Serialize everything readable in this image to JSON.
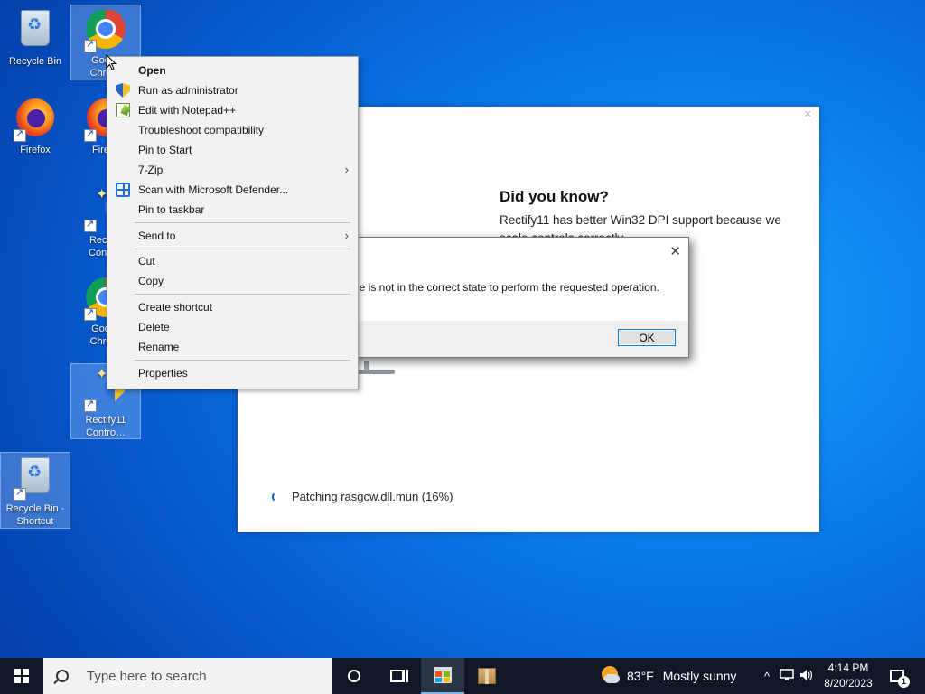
{
  "desktop": {
    "icons": [
      {
        "label": "Recycle Bin"
      },
      {
        "label": "Goo… Chro…"
      },
      {
        "label": "Firefox"
      },
      {
        "label": "Fire…"
      },
      {
        "label": "Recti… Contr…"
      },
      {
        "label": "Goo… Chro…"
      },
      {
        "label": "Rectify11 Contro…"
      },
      {
        "label": "Recycle Bin - Shortcut"
      }
    ]
  },
  "app_window": {
    "tip_title": "Did you know?",
    "tip_body": "Rectify11 has better Win32 DPI support because we scale controls correctly.",
    "close_glyph": "✕",
    "progress_text": "Patching rasgcw.dll.mun (16%)"
  },
  "error_dialog": {
    "message": "urce is not in the correct state to perform the requested operation.",
    "ok_label": "OK",
    "close_glyph": "✕"
  },
  "context_menu": {
    "items": [
      {
        "label": "Open",
        "icon": null
      },
      {
        "label": "Run as administrator",
        "icon": "uac-shield-icon"
      },
      {
        "label": "Edit with Notepad++",
        "icon": "notepad-plus-plus-icon"
      },
      {
        "label": "Troubleshoot compatibility",
        "icon": null
      },
      {
        "label": "Pin to Start",
        "icon": null
      },
      {
        "label": "7-Zip",
        "icon": null
      },
      {
        "label": "Scan with Microsoft Defender...",
        "icon": "defender-icon"
      },
      {
        "label": "Pin to taskbar",
        "icon": null
      },
      {
        "label": "Send to",
        "icon": null
      },
      {
        "label": "Cut",
        "icon": null
      },
      {
        "label": "Copy",
        "icon": null
      },
      {
        "label": "Create shortcut",
        "icon": null
      },
      {
        "label": "Delete",
        "icon": null
      },
      {
        "label": "Rename",
        "icon": null
      },
      {
        "label": "Properties",
        "icon": null
      }
    ],
    "submenu_arrow": "›"
  },
  "taskbar": {
    "search_placeholder": "Type here to search",
    "weather_temp": "83°F",
    "weather_desc": "Mostly sunny",
    "tray_chevron": "^",
    "time": "4:14 PM",
    "date": "8/20/2023",
    "notification_count": "1",
    "accent": "#76b9ed",
    "background": "#101827"
  }
}
